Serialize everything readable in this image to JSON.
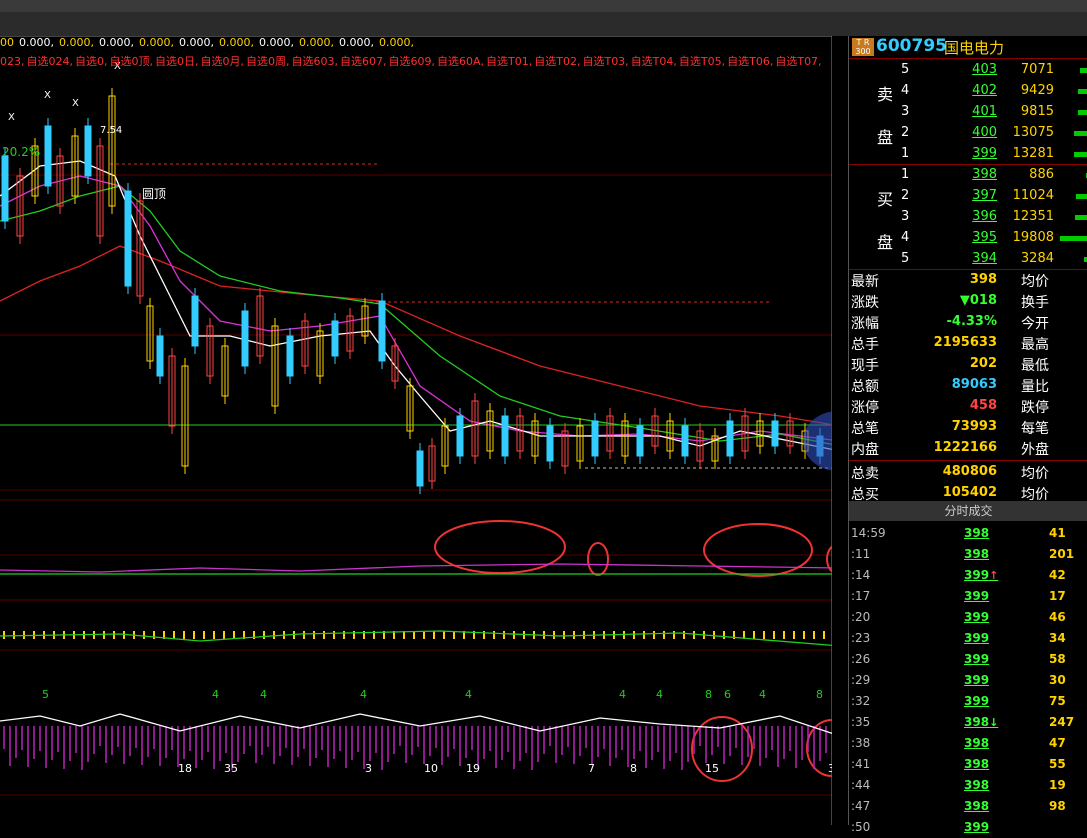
{
  "ma_line": [
    "00",
    "0.000,",
    "0.000,",
    "0.000,",
    "0.000,",
    "0.000,",
    "0.000,",
    "0.000,",
    "0.000,",
    "0.000,",
    "0.000,"
  ],
  "tabs": [
    "023",
    "自选024",
    "自选0",
    "自选0顶",
    "自选0日",
    "自选0月",
    "自选0周",
    "自选603",
    "自选607",
    "自选609",
    "自选60A",
    "自选T01",
    "自选T02",
    "自选T03",
    "自选T04",
    "自选T05",
    "自选T06",
    "自选T07"
  ],
  "chart_labels": {
    "pct": "20.2%",
    "peak_price": "7.54",
    "top_marker": "圆顶",
    "x_marks": [
      "X",
      "X",
      "X",
      "X"
    ]
  },
  "stock": {
    "logo_top": "T R",
    "logo_bottom": "300",
    "code": "600795",
    "name": "国电电力"
  },
  "sell_side_label": [
    "卖",
    "盘"
  ],
  "buy_side_label": [
    "买",
    "盘"
  ],
  "sell_orders": [
    {
      "level": "5",
      "price": "403",
      "volume": "7071",
      "bar": 8
    },
    {
      "level": "4",
      "price": "402",
      "volume": "9429",
      "bar": 10
    },
    {
      "level": "3",
      "price": "401",
      "volume": "9815",
      "bar": 10
    },
    {
      "level": "2",
      "price": "400",
      "volume": "13075",
      "bar": 14
    },
    {
      "level": "1",
      "price": "399",
      "volume": "13281",
      "bar": 14
    }
  ],
  "buy_orders": [
    {
      "level": "1",
      "price": "398",
      "volume": "886",
      "bar": 2
    },
    {
      "level": "2",
      "price": "397",
      "volume": "11024",
      "bar": 12
    },
    {
      "level": "3",
      "price": "396",
      "volume": "12351",
      "bar": 13
    },
    {
      "level": "4",
      "price": "395",
      "volume": "19808",
      "bar": 28
    },
    {
      "level": "5",
      "price": "394",
      "volume": "3284",
      "bar": 4
    }
  ],
  "stats": [
    {
      "k": "最新",
      "v": "398",
      "k2": "均价",
      "color": "#ffd200"
    },
    {
      "k": "涨跌",
      "v": "▼018",
      "k2": "换手",
      "color": "#3f3"
    },
    {
      "k": "涨幅",
      "v": "-4.33%",
      "k2": "今开",
      "color": "#3f3"
    },
    {
      "k": "总手",
      "v": "2195633",
      "k2": "最高",
      "color": "#ffd200"
    },
    {
      "k": "现手",
      "v": "202",
      "k2": "最低",
      "color": "#ffd200"
    },
    {
      "k": "总额",
      "v": "89063",
      "k2": "量比",
      "color": "#3cf"
    },
    {
      "k": "涨停",
      "v": "458",
      "k2": "跌停",
      "color": "#f44"
    },
    {
      "k": "总笔",
      "v": "73993",
      "k2": "每笔",
      "color": "#ffd200"
    },
    {
      "k": "内盘",
      "v": "1222166",
      "k2": "外盘",
      "color": "#ffd200"
    },
    {
      "k": "总卖",
      "v": "480806",
      "k2": "均价",
      "color": "#ffd200"
    },
    {
      "k": "总买",
      "v": "105402",
      "k2": "均价",
      "color": "#ffd200"
    }
  ],
  "ticks_header": "分时成交",
  "ticks": [
    {
      "time": "14:59",
      "price": "398",
      "arrow": "",
      "vol": "41"
    },
    {
      "time": ":11",
      "price": "398",
      "arrow": "",
      "vol": "201"
    },
    {
      "time": ":14",
      "price": "399",
      "arrow": "↑",
      "vol": "42"
    },
    {
      "time": ":17",
      "price": "399",
      "arrow": "",
      "vol": "17"
    },
    {
      "time": ":20",
      "price": "399",
      "arrow": "",
      "vol": "46"
    },
    {
      "time": ":23",
      "price": "399",
      "arrow": "",
      "vol": "34"
    },
    {
      "time": ":26",
      "price": "399",
      "arrow": "",
      "vol": "58"
    },
    {
      "time": ":29",
      "price": "399",
      "arrow": "",
      "vol": "30"
    },
    {
      "time": ":32",
      "price": "399",
      "arrow": "",
      "vol": "75"
    },
    {
      "time": ":35",
      "price": "398",
      "arrow": "↓",
      "vol": "247"
    },
    {
      "time": ":38",
      "price": "398",
      "arrow": "",
      "vol": "47"
    },
    {
      "time": ":41",
      "price": "398",
      "arrow": "",
      "vol": "55"
    },
    {
      "time": ":44",
      "price": "398",
      "arrow": "",
      "vol": "19"
    },
    {
      "time": ":47",
      "price": "398",
      "arrow": "",
      "vol": "98"
    },
    {
      "time": ":50",
      "price": "399",
      "arrow": "",
      "vol": ""
    }
  ],
  "bottom_numbers": [
    "5",
    "4",
    "4",
    "4",
    "4",
    "4",
    "4",
    "8",
    "6",
    "4",
    "8"
  ],
  "bottom_labels": [
    "18",
    "35",
    "3",
    "10",
    "19",
    "7",
    "8",
    "15",
    "3"
  ]
}
